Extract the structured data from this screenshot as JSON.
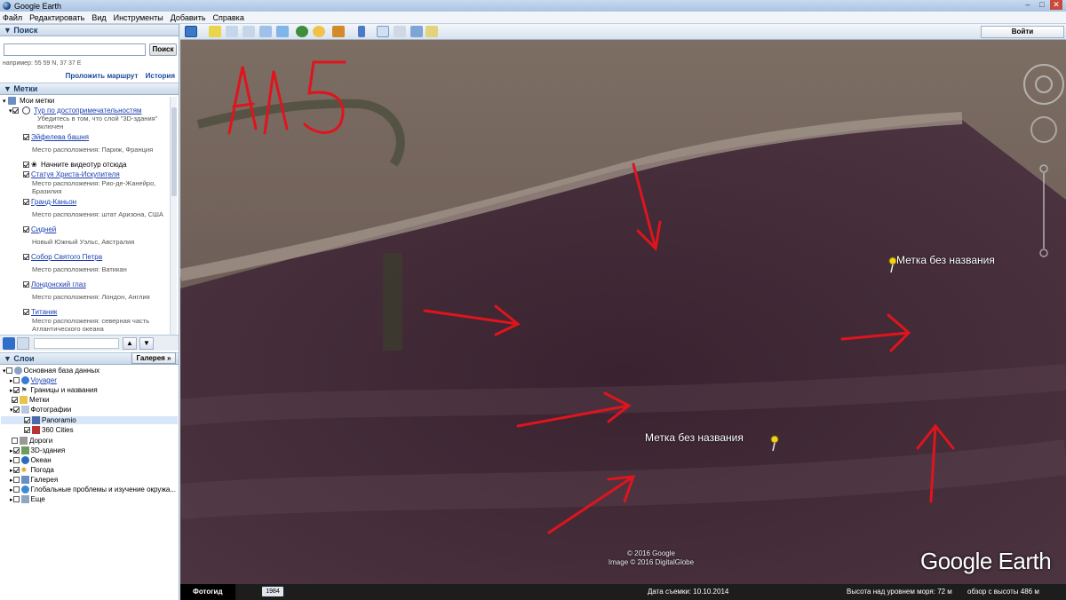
{
  "window": {
    "title": "Google Earth"
  },
  "menu": [
    "Файл",
    "Редактировать",
    "Вид",
    "Инструменты",
    "Добавить",
    "Справка"
  ],
  "search": {
    "header": "Поиск",
    "button": "Поиск",
    "hint": "например: 55 59 N, 37 37 E",
    "route": "Проложить маршрут",
    "history": "История",
    "value": ""
  },
  "places": {
    "header": "Метки",
    "root": "Мои метки",
    "tour": {
      "label": "Тур по достопримечательностям",
      "sub1": "Убедитесь в том, что слой \"3D-здания\"",
      "sub2": "включен"
    },
    "items": [
      {
        "label": "Эйфелева башня",
        "sub": "Место расположения: Париж, Франция"
      },
      {
        "label": "Начните видеотур отсюда",
        "sub": ""
      },
      {
        "label": "Статуя Христа-Искупителя",
        "sub": "Место расположения: Рио-де-Жанейро,",
        "sub2": "Бразилия"
      },
      {
        "label": "Гранд-Каньон",
        "sub": "Место расположения: штат Аризона, США"
      },
      {
        "label": "Сидней",
        "sub": "Новый Южный Уэльс, Австралия"
      },
      {
        "label": "Собор Святого Петра",
        "sub": "Место расположения: Ватикан"
      },
      {
        "label": "Лондонский глаз",
        "sub": "Место расположения: Лондон, Англия"
      },
      {
        "label": "Титаник",
        "sub": "Место расположения: северная часть",
        "sub2": "Атлантического океана"
      }
    ]
  },
  "layers": {
    "header": "Слои",
    "gallery": "Галерея »",
    "items": [
      "Основная база данных",
      "Voyager",
      "Границы и названия",
      "Метки",
      "Фотографии",
      "Panoramio",
      "360 Cities",
      "Дороги",
      "3D-здания",
      "Океан",
      "Погода",
      "Галерея",
      "Глобальные проблемы и изучение окружа...",
      "Еще"
    ]
  },
  "toolbar": {
    "signin": "Войти"
  },
  "map": {
    "label1": "Метка без названия",
    "label2": "Метка без названия",
    "copy1": "© 2016 Google",
    "copy2": "Image © 2016 DigitalGlobe",
    "logo": "Google Earth",
    "annotation": "АЛ5"
  },
  "status": {
    "mode": "Фотогид",
    "year": "1984",
    "date": "Дата съемки: 10.10.2014",
    "elevation": "Высота над уровнем моря:   72 м",
    "eye": "обзор с высоты   486 м"
  },
  "colors": {
    "annotation": "#e0141c",
    "pin": "#f2d21b",
    "panel_header": "#1b3d66"
  }
}
